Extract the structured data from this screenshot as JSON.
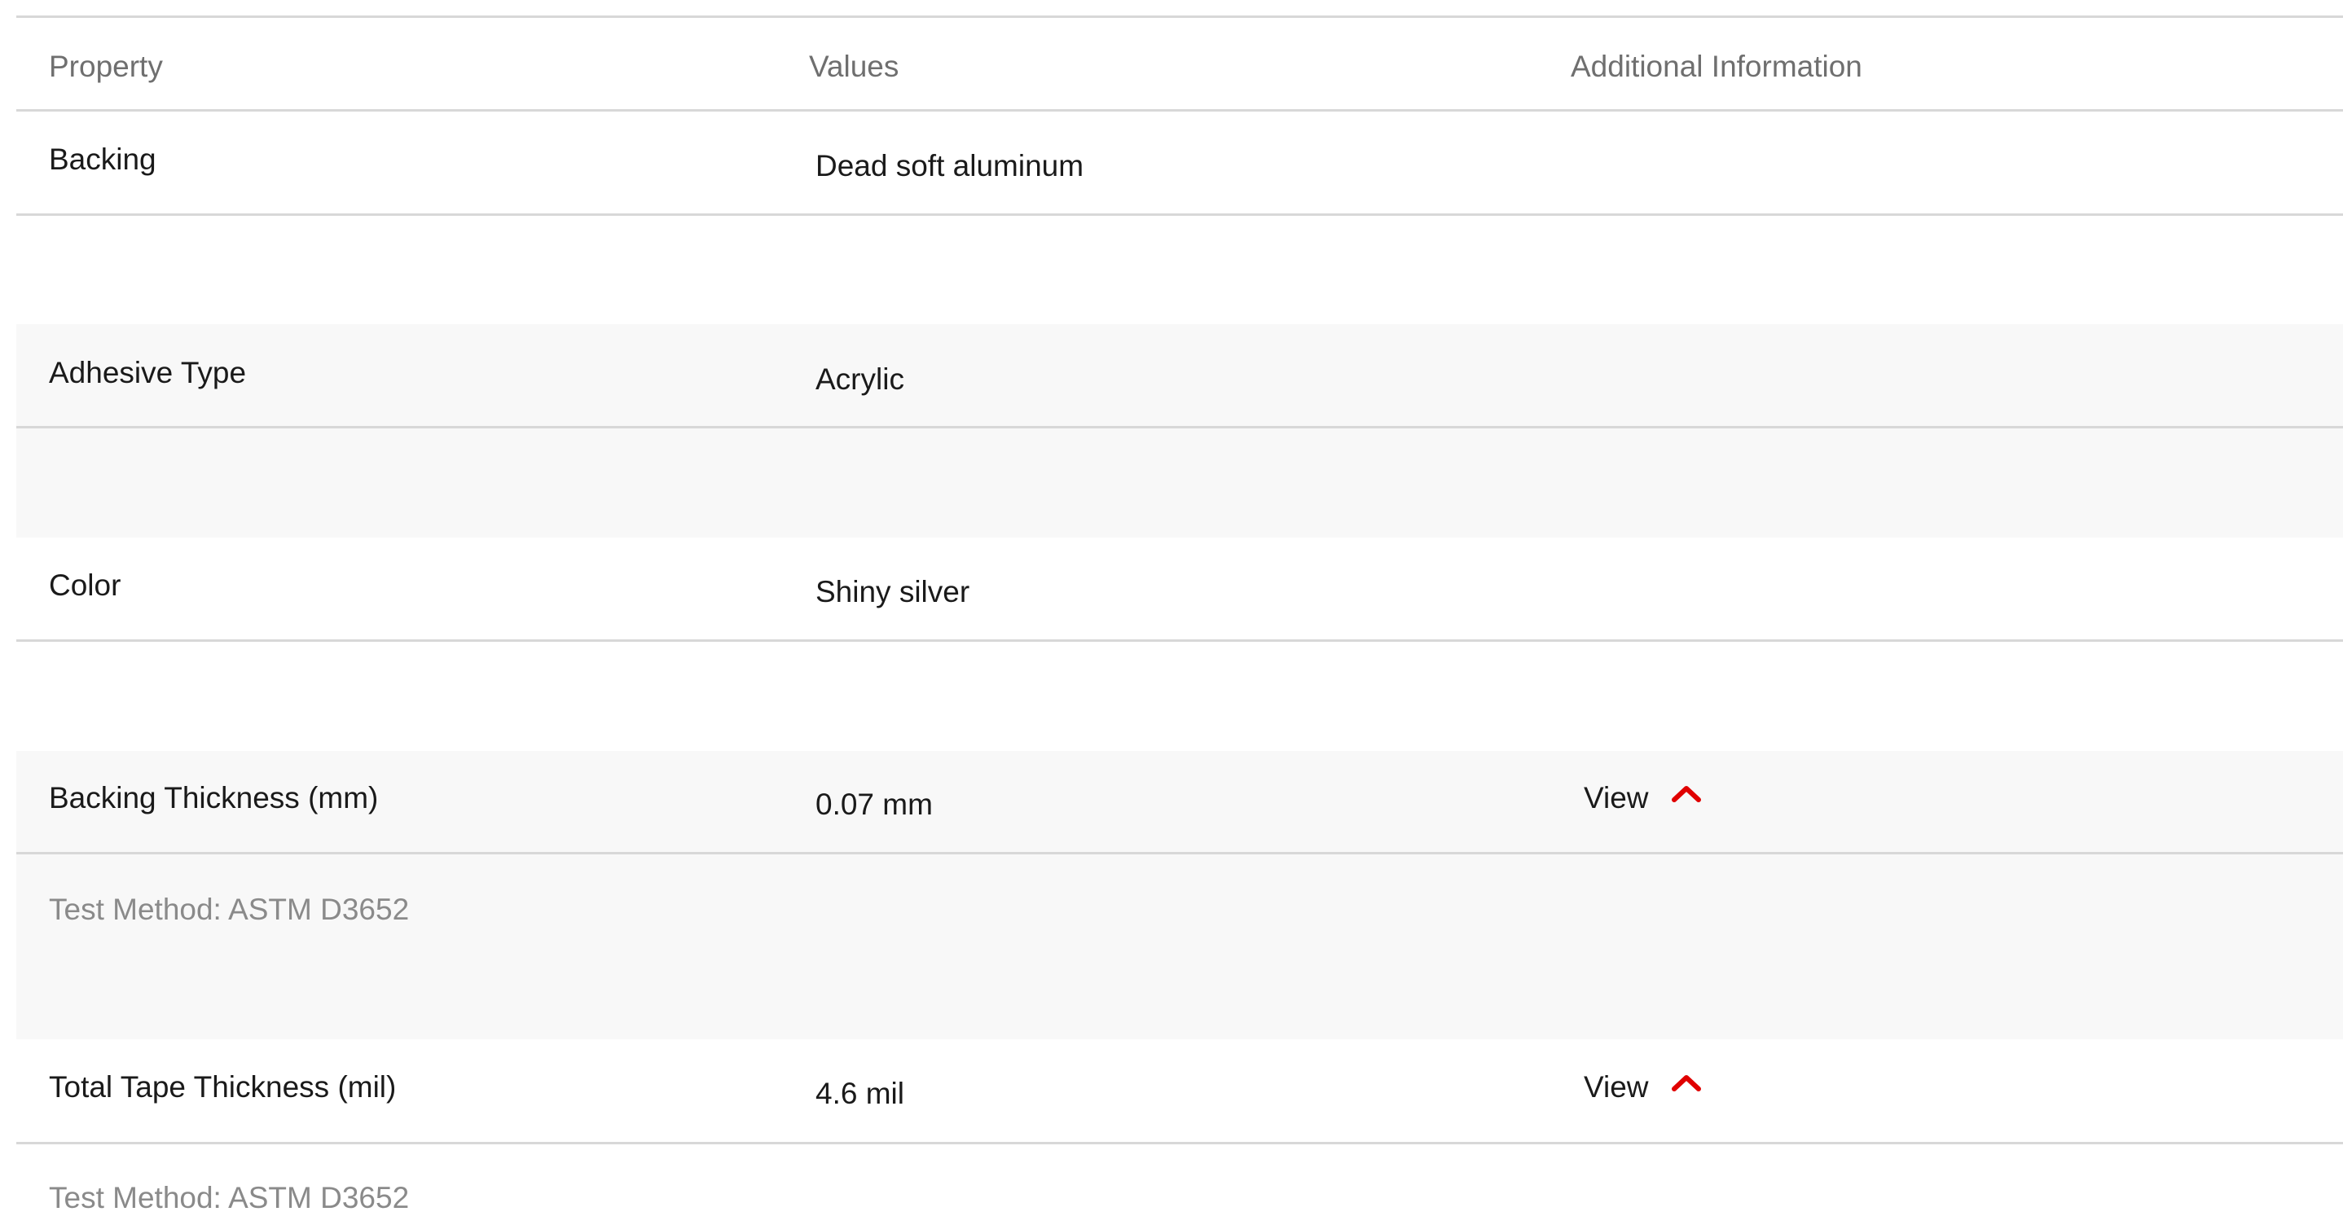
{
  "table": {
    "headers": {
      "property": "Property",
      "values": "Values",
      "additional": "Additional Information"
    },
    "rows": [
      {
        "property": "Backing",
        "value": "Dead soft aluminum"
      },
      {
        "property": "Adhesive Type",
        "value": "Acrylic"
      },
      {
        "property": "Color",
        "value": "Shiny silver"
      },
      {
        "property": "Backing Thickness (mm)",
        "value": "0.07 mm",
        "additional": "View",
        "method": "Test Method: ASTM D3652"
      },
      {
        "property": "Total Tape Thickness (mil)",
        "value": "4.6 mil",
        "additional": "View",
        "method": "Test Method: ASTM D3652"
      }
    ]
  },
  "colors": {
    "accent": "#e00000",
    "row_shade": "#f8f8f8",
    "divider": "#d8d8d8"
  },
  "icons": {
    "expand_toggle": "chevron-up-icon"
  }
}
